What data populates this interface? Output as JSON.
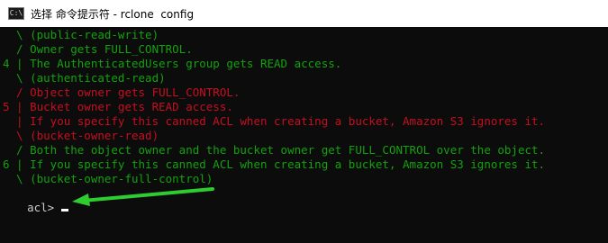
{
  "window": {
    "title": "选择 命令提示符 - rclone  config",
    "icon_label": "C:\\"
  },
  "colors": {
    "background": "#0c0c0c",
    "green_text": "#13a10e",
    "red_text": "#c50f1f",
    "arrow": "#2ecc2e"
  },
  "console": {
    "lines": [
      {
        "text": "  \\ (public-read-write)",
        "color": "green"
      },
      {
        "text": "  / Owner gets FULL_CONTROL.",
        "color": "green"
      },
      {
        "text": "4 | The AuthenticatedUsers group gets READ access.",
        "color": "green"
      },
      {
        "text": "  \\ (authenticated-read)",
        "color": "green"
      },
      {
        "text": "  / Object owner gets FULL_CONTROL.",
        "color": "red"
      },
      {
        "text": "5 | Bucket owner gets READ access.",
        "color": "red"
      },
      {
        "text": "  | If you specify this canned ACL when creating a bucket, Amazon S3 ignores it.",
        "color": "red"
      },
      {
        "text": "  \\ (bucket-owner-read)",
        "color": "red"
      },
      {
        "text": "  / Both the object owner and the bucket owner get FULL_CONTROL over the object.",
        "color": "green"
      },
      {
        "text": "6 | If you specify this canned ACL when creating a bucket, Amazon S3 ignores it.",
        "color": "green"
      },
      {
        "text": "  \\ (bucket-owner-full-control)",
        "color": "green"
      }
    ],
    "prompt": "acl>"
  }
}
